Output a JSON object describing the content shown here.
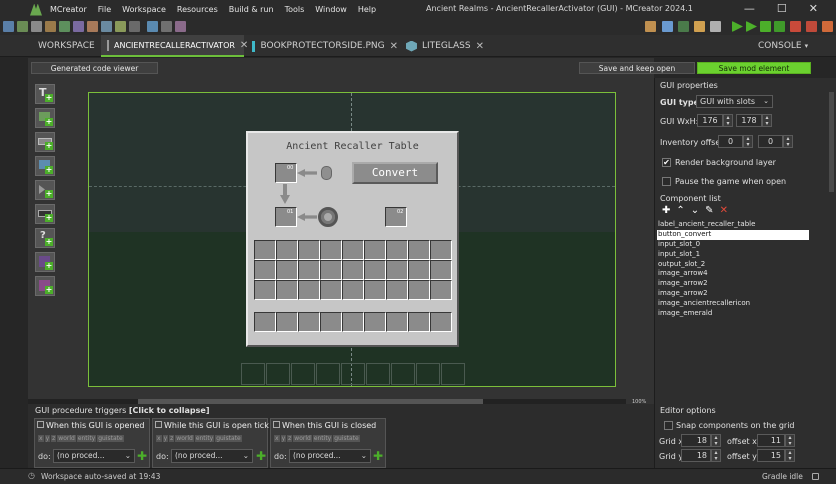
{
  "app": {
    "menu": [
      "MCreator",
      "File",
      "Workspace",
      "Resources",
      "Build & run",
      "Tools",
      "Window",
      "Help"
    ],
    "window_title": "Ancient Realms - AncientRecallerActivator (GUI) - MCreator 2024.1",
    "controls": {
      "minimize": "—",
      "maximize": "☐",
      "close": "✕"
    }
  },
  "tabs": {
    "workspace": "WORKSPACE",
    "items": [
      {
        "label": "ANCIENTRECALLERACTIVATOR",
        "close": "✕"
      },
      {
        "label": "BOOKPROTECTORSIDE.PNG",
        "close": "✕"
      },
      {
        "label": "LITEGLASS",
        "close": "✕"
      }
    ],
    "console": "CONSOLE"
  },
  "actions": {
    "code_viewer": "Generated code viewer",
    "save_keep_open": "Save and keep open",
    "save_mod_element": "Save mod element"
  },
  "gui_preview": {
    "title": "Ancient Recaller Table",
    "convert_label": "Convert",
    "slot_labels": [
      "00",
      "01",
      "02"
    ]
  },
  "gui_properties": {
    "header": "GUI properties",
    "gui_type_label": "GUI type:",
    "gui_type_value": "GUI with slots",
    "wxh_label": "GUI WxH:",
    "width": "176",
    "height": "178",
    "inventory_offset_label": "Inventory offset:",
    "offset_x": "0",
    "offset_y": "0",
    "render_bg_label": "Render background layer",
    "render_bg_checked": true,
    "pause_label": "Pause the game when open",
    "pause_checked": false,
    "check_mark": "✔"
  },
  "component_list": {
    "header": "Component list",
    "tools": {
      "add": "✚",
      "up": "⌃",
      "down": "⌄",
      "edit": "✎",
      "delete": "✕"
    },
    "items": [
      "label_ancient_recaller_table",
      "button_convert",
      "input_slot_0",
      "input_slot_1",
      "output_slot_2",
      "image_arrow4",
      "image_arrow2",
      "image_arrow2",
      "image_ancientrecallericon",
      "image_emerald"
    ],
    "selected_index": 1
  },
  "zoom": "100%",
  "procedures": {
    "header_prefix": "GUI procedure triggers",
    "header_link": "[Click to collapse]",
    "deps": [
      "x",
      "y",
      "z",
      "world",
      "entity",
      "guistate"
    ],
    "triggers": [
      {
        "label": "When this GUI is opened",
        "do": "do:",
        "value": "(no proced..."
      },
      {
        "label": "While this GUI is open tick",
        "do": "do:",
        "value": "(no proced..."
      },
      {
        "label": "When this GUI is closed",
        "do": "do:",
        "value": "(no proced..."
      }
    ],
    "add_icon": "✚",
    "edit_icon": "✎",
    "dropdown_arrow": "⌄"
  },
  "editor_options": {
    "header": "Editor options",
    "snap_label": "Snap components on the grid",
    "grid_x_label": "Grid x:",
    "grid_x": "18",
    "offset_x_label": "offset x:",
    "offset_x": "11",
    "grid_y_label": "Grid y:",
    "grid_y": "18",
    "offset_y_label": "offset y:",
    "offset_y": "15"
  },
  "status": {
    "message": "Workspace auto-saved at 19:43",
    "gradle": "Gradle idle"
  },
  "colors": {
    "accent_green": "#6dbf3b",
    "save_green": "#6bd12f",
    "canvas_border": "#7bbf3a",
    "selected_row": "#ffffff"
  }
}
